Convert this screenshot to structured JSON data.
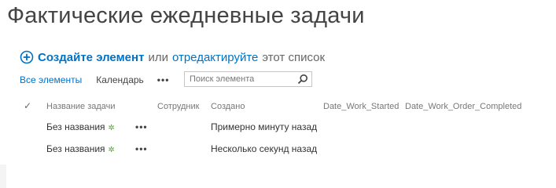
{
  "page": {
    "title": "Фактические ежедневные задачи"
  },
  "command": {
    "create_label": "Создайте элемент",
    "or_label": "или",
    "edit_label": "отредактируйте",
    "tail_label": "этот список"
  },
  "views": {
    "all_items": "Все элементы",
    "calendar": "Календарь",
    "more": "•••"
  },
  "search": {
    "placeholder": "Поиск элемента",
    "value": ""
  },
  "columns": {
    "check": "✓",
    "task_name": "Название задачи",
    "employee": "Сотрудник",
    "created": "Создано",
    "date_work_started": "Date_Work_Started",
    "date_work_order_completed": "Date_Work_Order_Completed"
  },
  "rows": [
    {
      "title": "Без названия",
      "new_marker": "✲",
      "menu": "•••",
      "employee": "",
      "created": "Примерно минуту назад"
    },
    {
      "title": "Без названия",
      "new_marker": "✲",
      "menu": "•••",
      "employee": "",
      "created": "Несколько секунд назад"
    }
  ],
  "icons": {
    "plus": "plus-circle-icon",
    "search": "search-icon",
    "new": "new-item-icon"
  },
  "colors": {
    "accent": "#0072c6",
    "title": "#444444",
    "new_marker": "#4caf1f",
    "header_text": "#777777"
  }
}
